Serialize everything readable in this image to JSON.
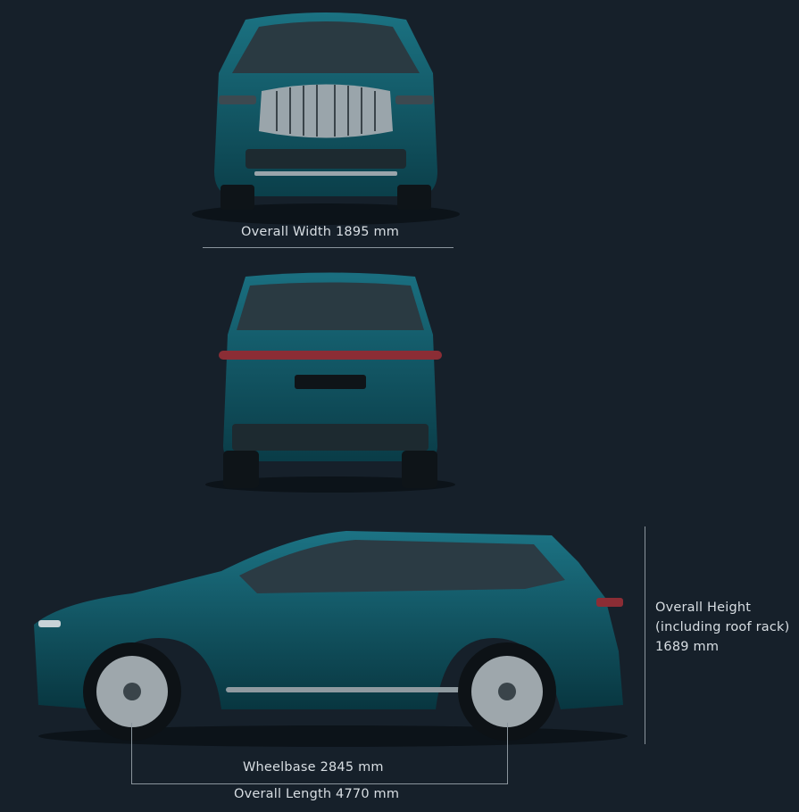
{
  "views": {
    "front": {
      "label": "Overall Width 1895 mm"
    },
    "rear": {
      "label": ""
    },
    "side": {
      "height_label": [
        "Overall Height",
        "(including roof rack)",
        "1689 mm"
      ],
      "wheelbase_label": "Wheelbase 2845 mm",
      "length_label": "Overall Length 4770 mm"
    }
  },
  "colors": {
    "background": "#16202a",
    "body_paint": "#0f5f6e",
    "dimension_lines": "#8a949c"
  }
}
